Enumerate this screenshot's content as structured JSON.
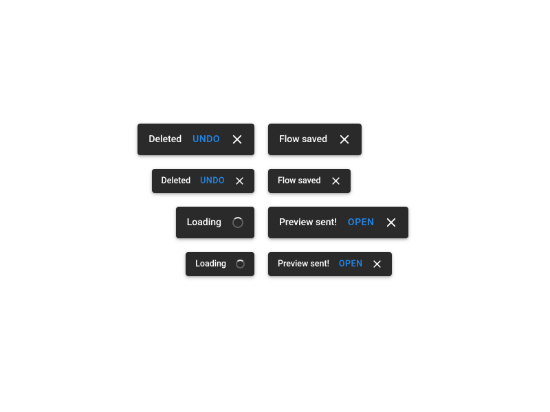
{
  "snackbars": {
    "deleted": {
      "message": "Deleted",
      "action": "UNDO"
    },
    "flow_saved": {
      "message": "Flow saved"
    },
    "loading": {
      "message": "Loading"
    },
    "preview_sent": {
      "message": "Preview sent!",
      "action": "OPEN"
    }
  },
  "colors": {
    "background": "#2a2a2a",
    "action": "#2383e2"
  }
}
